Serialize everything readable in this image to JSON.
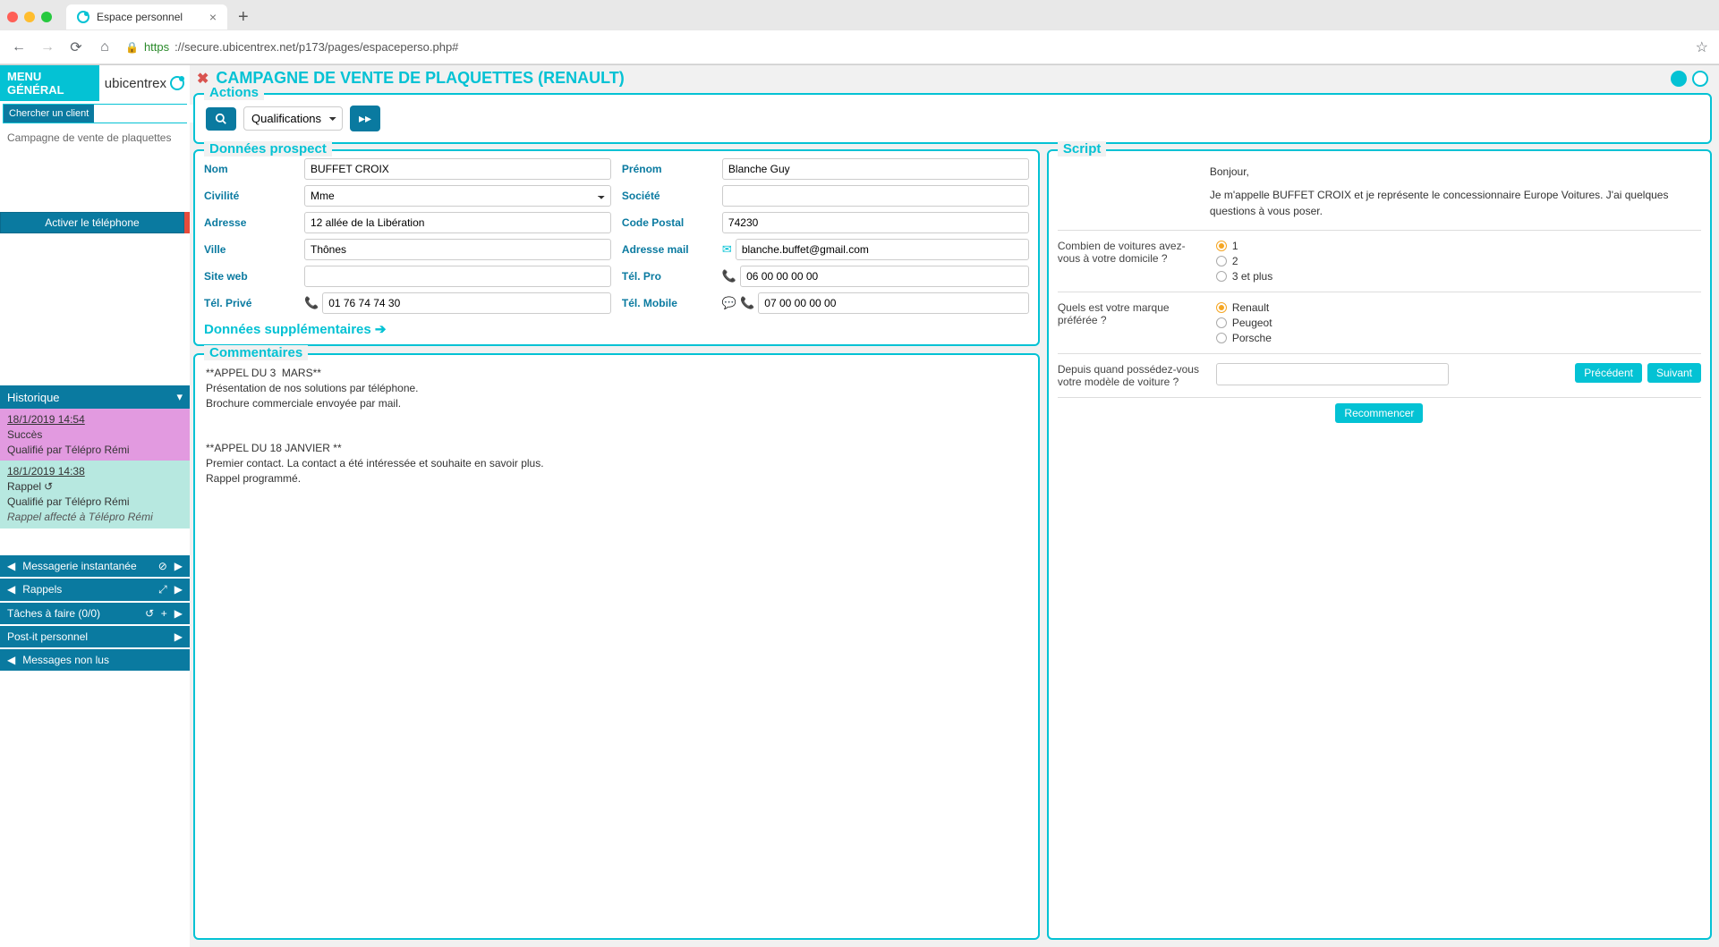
{
  "browser": {
    "tab_title": "Espace personnel",
    "url_prefix": "https",
    "url_rest": "://secure.ubicentrex.net/p173/pages/espaceperso.php#"
  },
  "sidebar": {
    "menu_general": "MENU GÉNÉRAL",
    "brand": "ubicentrex",
    "search_label": "Chercher un client",
    "campaign_link": "Campagne de vente de plaquettes",
    "activate_phone": "Activer le téléphone",
    "historique": "Historique",
    "history": [
      {
        "datetime": "18/1/2019 14:54",
        "status": "Succès",
        "by": "Qualifié par Télépro Rémi",
        "class": "success"
      },
      {
        "datetime": "18/1/2019 14:38",
        "status": "Rappel ",
        "status_icon": "↻",
        "by": "Qualifié par Télépro Rémi",
        "assign": "Rappel affecté à Télépro Rémi",
        "class": "rappel"
      }
    ],
    "panels": {
      "messagerie": "Messagerie instantanée",
      "rappels": "Rappels",
      "taches": "Tâches à faire (0/0)",
      "postit": "Post-it personnel",
      "messages": "Messages non lus"
    }
  },
  "header": {
    "title": "CAMPAGNE DE VENTE DE PLAQUETTES (RENAULT)"
  },
  "actions": {
    "legend": "Actions",
    "qualification_selected": "Qualifications"
  },
  "prospect": {
    "legend": "Données prospect",
    "labels": {
      "nom": "Nom",
      "prenom": "Prénom",
      "civilite": "Civilité",
      "societe": "Société",
      "adresse": "Adresse",
      "cp": "Code Postal",
      "ville": "Ville",
      "mail": "Adresse mail",
      "site": "Site web",
      "telpro": "Tél. Pro",
      "telprive": "Tél. Privé",
      "telmob": "Tél. Mobile"
    },
    "values": {
      "nom": "BUFFET CROIX",
      "prenom": "Blanche Guy",
      "civilite": "Mme",
      "societe": "",
      "adresse": "12 allée de la Libération",
      "cp": "74230",
      "ville": "Thônes",
      "mail": "blanche.buffet@gmail.com",
      "site": "",
      "telpro": "06 00 00 00 00",
      "telprive": "01 76 74 74 30",
      "telmob": "07 00 00 00 00"
    },
    "supp": "Données supplémentaires"
  },
  "comments": {
    "legend": "Commentaires",
    "text": "**APPEL DU 3  MARS**\nPrésentation de nos solutions par téléphone.\nBrochure commerciale envoyée par mail.\n\n\n**APPEL DU 18 JANVIER **\nPremier contact. La contact a été intéressée et souhaite en savoir plus.\nRappel programmé."
  },
  "script": {
    "legend": "Script",
    "intro_line1": "Bonjour,",
    "intro_line2": "Je m'appelle BUFFET CROIX et je représente le concessionnaire Europe Voitures. J'ai quelques questions à vous poser.",
    "q1": {
      "text": "Combien de voitures avez-vous à votre domicile ?",
      "options": [
        "1",
        "2",
        "3 et plus"
      ],
      "selected": 0
    },
    "q2": {
      "text": "Quels est votre marque préférée ?",
      "options": [
        "Renault",
        "Peugeot",
        "Porsche"
      ],
      "selected": 0
    },
    "q3": {
      "text": "Depuis quand possédez-vous votre modèle de voiture ?",
      "value": ""
    },
    "btn_prev": "Précédent",
    "btn_next": "Suivant",
    "btn_restart": "Recommencer"
  }
}
